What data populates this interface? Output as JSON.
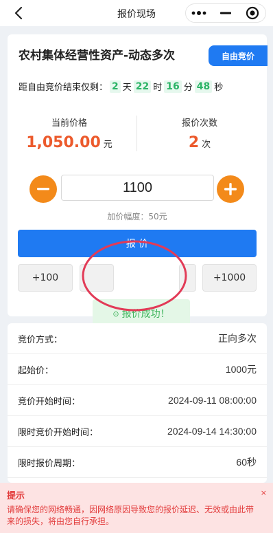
{
  "nav": {
    "title": "报价现场",
    "back_icon": "chevron-left-icon",
    "more_icon": "more-dots-icon",
    "minimize_icon": "minimize-icon",
    "close_icon": "record-target-icon"
  },
  "auction": {
    "title": "农村集体经营性资产-动态多次",
    "tag": "自由竞价",
    "countdown": {
      "prefix": "距自由竞价结束仅剩：",
      "days": "2",
      "days_unit": "天",
      "hours": "22",
      "hours_unit": "时",
      "minutes": "16",
      "minutes_unit": "分",
      "seconds": "48",
      "seconds_unit": "秒"
    },
    "current_price": {
      "label": "当前价格",
      "value": "1,050.00",
      "unit": "元"
    },
    "bid_count": {
      "label": "报价次数",
      "value": "2",
      "unit": "次"
    },
    "input_value": "1100",
    "increment_label": "加价幅度：50元",
    "bid_button": "报 价",
    "quick_add": [
      "+100",
      "+1000"
    ],
    "toast": "报价成功！"
  },
  "info": [
    {
      "label": "竞价方式：",
      "value": "正向多次"
    },
    {
      "label": "起始价：",
      "value": "1000元"
    },
    {
      "label": "竞价开始时间：",
      "value": "2024-09-11 08:00:00"
    },
    {
      "label": "限时竞价开始时间：",
      "value": "2024-09-14 14:30:00"
    },
    {
      "label": "限时报价周期：",
      "value": "60秒"
    }
  ],
  "tip": {
    "title": "提示",
    "text": "请确保您的网络畅通，因网络原因导致您的报价延迟、无效或由此带来的损失，将由您自行承担。",
    "close": "×"
  },
  "colors": {
    "primary": "#1f7af2",
    "price": "#ec5a2c",
    "stepper": "#f38a1a",
    "countdown_bg": "#e6f8ee",
    "countdown_text": "#2bb466",
    "annotation": "#e23b57",
    "tip": "#e23b3b"
  }
}
